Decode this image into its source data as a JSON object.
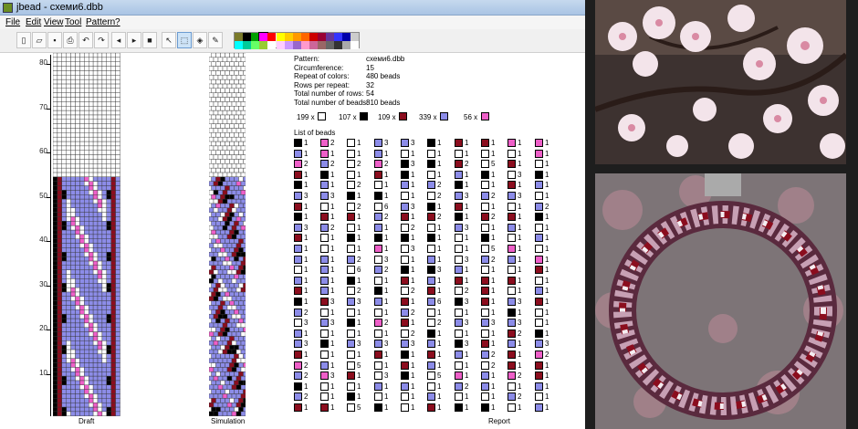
{
  "window": {
    "title": "jbead - схеми6.dbb"
  },
  "menu": [
    "File",
    "Edit",
    "View",
    "Tool",
    "Pattern",
    "?"
  ],
  "toolbar": {
    "buttons": [
      {
        "name": "new-button",
        "glyph": "▯"
      },
      {
        "name": "open-button",
        "glyph": "▱"
      },
      {
        "name": "save-button",
        "glyph": "▪"
      },
      {
        "name": "print-button",
        "glyph": "⎙"
      },
      {
        "name": "undo-button",
        "glyph": "↶"
      },
      {
        "name": "redo-button",
        "glyph": "↷"
      },
      {
        "name": "shift-left-button",
        "glyph": "◂"
      },
      {
        "name": "shift-right-button",
        "glyph": "▸"
      },
      {
        "name": "stop-button",
        "glyph": "■"
      },
      {
        "name": "pointer-tool",
        "glyph": "↖"
      },
      {
        "name": "select-tool",
        "glyph": "⬚"
      },
      {
        "name": "fill-tool",
        "glyph": "◈"
      },
      {
        "name": "pick-tool",
        "glyph": "✎"
      }
    ]
  },
  "palette": [
    "#7a7a2a",
    "#000000",
    "#00a000",
    "#ff00ff",
    "#ff0000",
    "#ffff00",
    "#ffcc00",
    "#ff9900",
    "#ff6600",
    "#cc0000",
    "#990033",
    "#663399",
    "#3333ff",
    "#0000aa",
    "#cccccc",
    "#00ffff",
    "#00cc99",
    "#66ff66",
    "#99cc33",
    "#ffffff",
    "#ffccff",
    "#cc99ff",
    "#9966cc",
    "#ff99cc",
    "#cc6699",
    "#996666",
    "#666666",
    "#333333",
    "#aaaaaa",
    "#ffffff"
  ],
  "palette_selected": 3,
  "colors": {
    "white": "#ffffff",
    "black": "#000000",
    "red": "#8b0d1e",
    "blue": "#8c8ce8",
    "pink": "#ee5fc8"
  },
  "ruler": {
    "labels": [
      "80",
      "70",
      "60",
      "50",
      "40",
      "30",
      "20",
      "10"
    ]
  },
  "info": {
    "rows": [
      {
        "label": "Pattern:",
        "value": "схеми6.dbb"
      },
      {
        "label": "Circumference:",
        "value": "15"
      },
      {
        "label": "Repeat of colors:",
        "value": "480 beads"
      },
      {
        "label": "Rows per repeat:",
        "value": "32"
      },
      {
        "label": "Total number of rows:",
        "value": "54"
      },
      {
        "label": "Total number of beads:",
        "value": "810 beads"
      }
    ],
    "counts": [
      {
        "text": "199 x",
        "color": "white"
      },
      {
        "text": "107 x",
        "color": "black"
      },
      {
        "text": "109 x",
        "color": "red"
      },
      {
        "text": "339 x",
        "color": "blue"
      },
      {
        "text": "56 x",
        "color": "pink"
      }
    ],
    "list_title": "List of beads"
  },
  "bead_list": [
    [
      [
        "black",
        "1"
      ],
      [
        "pink",
        "2"
      ],
      [
        "white",
        "1"
      ],
      [
        "blue",
        "3"
      ],
      [
        "blue",
        "3"
      ],
      [
        "black",
        "1"
      ],
      [
        "red",
        "1"
      ],
      [
        "red",
        "1"
      ],
      [
        "pink",
        "1"
      ],
      [
        "pink",
        "1"
      ]
    ],
    [
      [
        "blue",
        "1"
      ],
      [
        "pink",
        "1"
      ],
      [
        "white",
        "1"
      ],
      [
        "blue",
        "1"
      ],
      [
        "white",
        "1"
      ],
      [
        "white",
        "1"
      ],
      [
        "white",
        "1"
      ],
      [
        "white",
        "1"
      ],
      [
        "white",
        "1"
      ],
      [
        "pink",
        "1"
      ]
    ],
    [
      [
        "pink",
        "2"
      ],
      [
        "blue",
        "2"
      ],
      [
        "white",
        "2"
      ],
      [
        "pink",
        "2"
      ],
      [
        "black",
        "3"
      ],
      [
        "black",
        "1"
      ],
      [
        "red",
        "2"
      ],
      [
        "white",
        "5"
      ],
      [
        "red",
        "1"
      ],
      [
        "white",
        "1"
      ]
    ],
    [
      [
        "red",
        "1"
      ],
      [
        "black",
        "1"
      ],
      [
        "white",
        "1"
      ],
      [
        "red",
        "1"
      ],
      [
        "black",
        "1"
      ],
      [
        "white",
        "1"
      ],
      [
        "blue",
        "1"
      ],
      [
        "black",
        "1"
      ],
      [
        "white",
        "3"
      ],
      [
        "black",
        "1"
      ]
    ],
    [
      [
        "black",
        "1"
      ],
      [
        "blue",
        "1"
      ],
      [
        "white",
        "2"
      ],
      [
        "white",
        "1"
      ],
      [
        "blue",
        "1"
      ],
      [
        "blue",
        "2"
      ],
      [
        "black",
        "1"
      ],
      [
        "white",
        "1"
      ],
      [
        "red",
        "1"
      ],
      [
        "blue",
        "1"
      ]
    ],
    [
      [
        "blue",
        "3"
      ],
      [
        "blue",
        "3"
      ],
      [
        "black",
        "1"
      ],
      [
        "black",
        "1"
      ],
      [
        "white",
        "1"
      ],
      [
        "white",
        "2"
      ],
      [
        "blue",
        "3"
      ],
      [
        "blue",
        "2"
      ],
      [
        "blue",
        "3"
      ],
      [
        "white",
        "1"
      ]
    ],
    [
      [
        "red",
        "1"
      ],
      [
        "white",
        "1"
      ],
      [
        "white",
        "2"
      ],
      [
        "white",
        "6"
      ],
      [
        "blue",
        "3"
      ],
      [
        "black",
        "1"
      ],
      [
        "red",
        "1"
      ],
      [
        "white",
        "1"
      ],
      [
        "white",
        "1"
      ],
      [
        "blue",
        "2"
      ]
    ],
    [
      [
        "black",
        "1"
      ],
      [
        "red",
        "1"
      ],
      [
        "red",
        "1"
      ],
      [
        "blue",
        "2"
      ],
      [
        "red",
        "1"
      ],
      [
        "red",
        "2"
      ],
      [
        "black",
        "1"
      ],
      [
        "red",
        "2"
      ],
      [
        "red",
        "1"
      ],
      [
        "black",
        "1"
      ]
    ],
    [
      [
        "blue",
        "3"
      ],
      [
        "blue",
        "2"
      ],
      [
        "white",
        "1"
      ],
      [
        "blue",
        "1"
      ],
      [
        "white",
        "2"
      ],
      [
        "white",
        "1"
      ],
      [
        "blue",
        "3"
      ],
      [
        "white",
        "1"
      ],
      [
        "blue",
        "1"
      ],
      [
        "white",
        "1"
      ]
    ],
    [
      [
        "red",
        "1"
      ],
      [
        "white",
        "1"
      ],
      [
        "black",
        "1"
      ],
      [
        "black",
        "1"
      ],
      [
        "black",
        "1"
      ],
      [
        "black",
        "1"
      ],
      [
        "white",
        "1"
      ],
      [
        "black",
        "1"
      ],
      [
        "white",
        "1"
      ],
      [
        "blue",
        "1"
      ]
    ],
    [
      [
        "blue",
        "1"
      ],
      [
        "white",
        "1"
      ],
      [
        "white",
        "1"
      ],
      [
        "pink",
        "1"
      ],
      [
        "white",
        "3"
      ],
      [
        "white",
        "1"
      ],
      [
        "white",
        "1"
      ],
      [
        "white",
        "5"
      ],
      [
        "pink",
        "1"
      ],
      [
        "white",
        "1"
      ]
    ],
    [
      [
        "blue",
        "1"
      ],
      [
        "blue",
        "1"
      ],
      [
        "blue",
        "2"
      ],
      [
        "white",
        "3"
      ],
      [
        "white",
        "1"
      ],
      [
        "blue",
        "1"
      ],
      [
        "white",
        "3"
      ],
      [
        "blue",
        "2"
      ],
      [
        "blue",
        "1"
      ],
      [
        "pink",
        "1"
      ]
    ],
    [
      [
        "white",
        "1"
      ],
      [
        "blue",
        "1"
      ],
      [
        "white",
        "6"
      ],
      [
        "blue",
        "2"
      ],
      [
        "black",
        "1"
      ],
      [
        "black",
        "3"
      ],
      [
        "blue",
        "1"
      ],
      [
        "white",
        "1"
      ],
      [
        "white",
        "1"
      ],
      [
        "red",
        "1"
      ]
    ],
    [
      [
        "blue",
        "1"
      ],
      [
        "blue",
        "1"
      ],
      [
        "black",
        "1"
      ],
      [
        "white",
        "1"
      ],
      [
        "red",
        "1"
      ],
      [
        "blue",
        "1"
      ],
      [
        "red",
        "1"
      ],
      [
        "red",
        "1"
      ],
      [
        "red",
        "1"
      ],
      [
        "white",
        "1"
      ]
    ],
    [
      [
        "red",
        "1"
      ],
      [
        "blue",
        "1"
      ],
      [
        "white",
        "2"
      ],
      [
        "black",
        "1"
      ],
      [
        "white",
        "2"
      ],
      [
        "red",
        "1"
      ],
      [
        "white",
        "2"
      ],
      [
        "red",
        "1"
      ],
      [
        "white",
        "1"
      ],
      [
        "blue",
        "1"
      ]
    ],
    [
      [
        "black",
        "1"
      ],
      [
        "red",
        "3"
      ],
      [
        "blue",
        "3"
      ],
      [
        "blue",
        "1"
      ],
      [
        "red",
        "1"
      ],
      [
        "blue",
        "6"
      ],
      [
        "black",
        "3"
      ],
      [
        "red",
        "1"
      ],
      [
        "blue",
        "3"
      ],
      [
        "red",
        "1"
      ]
    ],
    [
      [
        "blue",
        "2"
      ],
      [
        "white",
        "1"
      ],
      [
        "white",
        "1"
      ],
      [
        "white",
        "1"
      ],
      [
        "blue",
        "2"
      ],
      [
        "white",
        "1"
      ],
      [
        "white",
        "1"
      ],
      [
        "white",
        "1"
      ],
      [
        "black",
        "1"
      ],
      [
        "white",
        "1"
      ]
    ],
    [
      [
        "white",
        "3"
      ],
      [
        "blue",
        "3"
      ],
      [
        "black",
        "1"
      ],
      [
        "pink",
        "2"
      ],
      [
        "red",
        "1"
      ],
      [
        "white",
        "2"
      ],
      [
        "blue",
        "3"
      ],
      [
        "blue",
        "3"
      ],
      [
        "blue",
        "3"
      ],
      [
        "white",
        "1"
      ]
    ],
    [
      [
        "blue",
        "1"
      ],
      [
        "white",
        "1"
      ],
      [
        "white",
        "1"
      ],
      [
        "white",
        "1"
      ],
      [
        "white",
        "2"
      ],
      [
        "black",
        "1"
      ],
      [
        "white",
        "1"
      ],
      [
        "white",
        "1"
      ],
      [
        "red",
        "2"
      ],
      [
        "black",
        "1"
      ]
    ],
    [
      [
        "blue",
        "3"
      ],
      [
        "black",
        "1"
      ],
      [
        "blue",
        "3"
      ],
      [
        "blue",
        "3"
      ],
      [
        "blue",
        "3"
      ],
      [
        "blue",
        "1"
      ],
      [
        "black",
        "3"
      ],
      [
        "red",
        "1"
      ],
      [
        "blue",
        "1"
      ],
      [
        "blue",
        "3"
      ]
    ],
    [
      [
        "red",
        "1"
      ],
      [
        "white",
        "1"
      ],
      [
        "white",
        "1"
      ],
      [
        "red",
        "1"
      ],
      [
        "black",
        "1"
      ],
      [
        "red",
        "1"
      ],
      [
        "blue",
        "1"
      ],
      [
        "blue",
        "2"
      ],
      [
        "red",
        "1"
      ],
      [
        "pink",
        "2"
      ]
    ],
    [
      [
        "pink",
        "2"
      ],
      [
        "blue",
        "1"
      ],
      [
        "white",
        "5"
      ],
      [
        "white",
        "1"
      ],
      [
        "red",
        "1"
      ],
      [
        "blue",
        "1"
      ],
      [
        "white",
        "1"
      ],
      [
        "white",
        "2"
      ],
      [
        "red",
        "1"
      ],
      [
        "red",
        "1"
      ]
    ],
    [
      [
        "blue",
        "2"
      ],
      [
        "pink",
        "3"
      ],
      [
        "red",
        "1"
      ],
      [
        "white",
        "3"
      ],
      [
        "black",
        "1"
      ],
      [
        "white",
        "5"
      ],
      [
        "pink",
        "1"
      ],
      [
        "blue",
        "1"
      ],
      [
        "pink",
        "2"
      ],
      [
        "red",
        "1"
      ]
    ],
    [
      [
        "black",
        "1"
      ],
      [
        "white",
        "1"
      ],
      [
        "white",
        "1"
      ],
      [
        "blue",
        "1"
      ],
      [
        "blue",
        "1"
      ],
      [
        "white",
        "1"
      ],
      [
        "blue",
        "2"
      ],
      [
        "blue",
        "1"
      ],
      [
        "white",
        "1"
      ],
      [
        "blue",
        "1"
      ]
    ],
    [
      [
        "blue",
        "2"
      ],
      [
        "white",
        "1"
      ],
      [
        "black",
        "1"
      ],
      [
        "white",
        "1"
      ],
      [
        "white",
        "1"
      ],
      [
        "blue",
        "1"
      ],
      [
        "white",
        "1"
      ],
      [
        "white",
        "1"
      ],
      [
        "blue",
        "2"
      ],
      [
        "white",
        "1"
      ]
    ],
    [
      [
        "red",
        "1"
      ],
      [
        "red",
        "1"
      ],
      [
        "white",
        "5"
      ],
      [
        "black",
        "1"
      ],
      [
        "white",
        "1"
      ],
      [
        "red",
        "1"
      ],
      [
        "black",
        "1"
      ],
      [
        "black",
        "1"
      ],
      [
        "white",
        "1"
      ],
      [
        "blue",
        "1"
      ]
    ]
  ],
  "labels": {
    "draft": "Draft",
    "simulation": "Simulation",
    "report": "Report"
  }
}
